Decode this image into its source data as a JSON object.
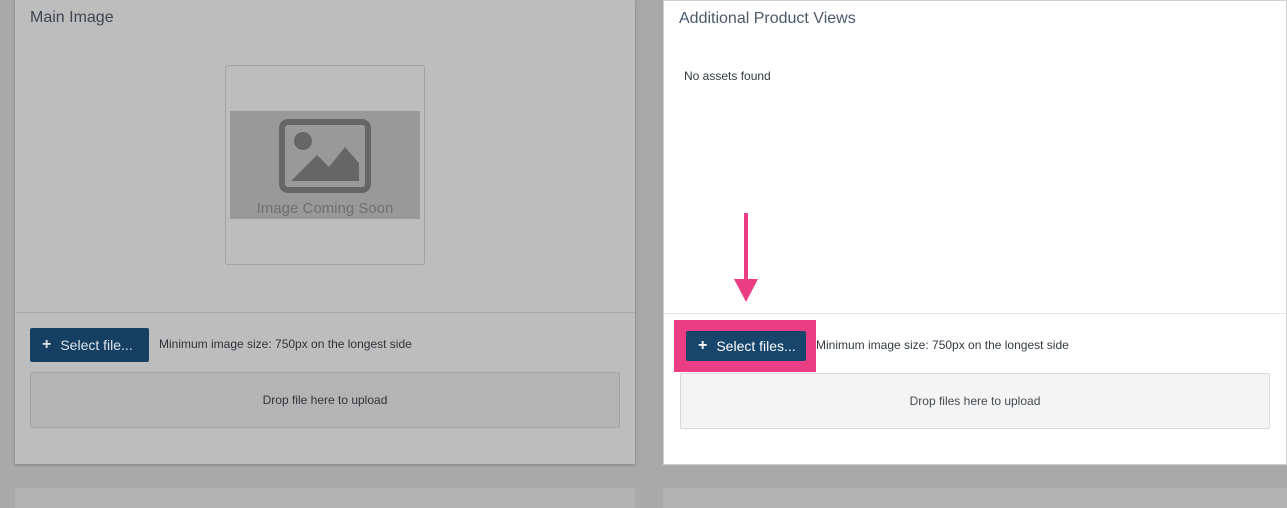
{
  "main_image": {
    "title": "Main Image",
    "placeholder_text": "Image Coming Soon",
    "select_button_label": "Select file...",
    "hint": "Minimum image size: 750px on the longest side",
    "dropzone_text": "Drop file here to upload"
  },
  "additional_views": {
    "title": "Additional Product Views",
    "empty_message": "No assets found",
    "select_button_label": "Select files...",
    "hint": "Minimum image size: 750px on the longest side",
    "dropzone_text": "Drop files here to upload"
  },
  "colors": {
    "accent_button": "#17456b",
    "highlight": "#ea3d84",
    "overlay": "#a9a9a9"
  },
  "icons": [
    "plus-icon",
    "image-placeholder-icon",
    "down-arrow-annotation"
  ]
}
